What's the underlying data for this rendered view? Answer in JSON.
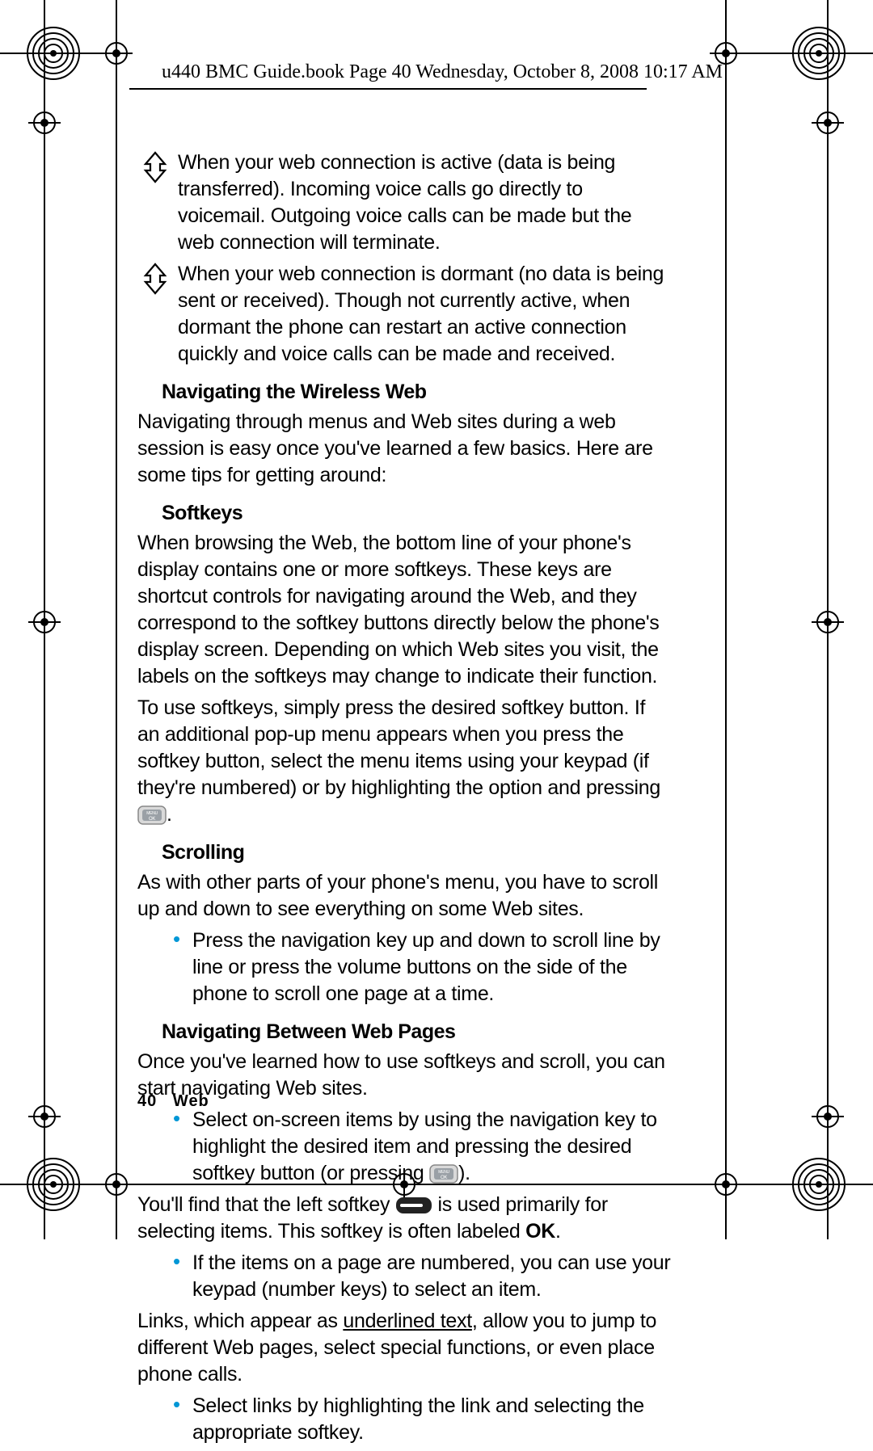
{
  "header": "u440 BMC Guide.book  Page 40  Wednesday, October 8, 2008  10:17 AM",
  "icon1_text": "When your web connection is active (data is being transferred). Incoming voice calls go directly to voicemail. Outgoing voice calls can be made but the web connection will terminate.",
  "icon2_text": "When your web connection is dormant (no data is being sent or received). Though not currently active, when dormant the phone can restart an active connection quickly and voice calls can be made and received.",
  "h_navweb": "Navigating the Wireless Web",
  "p_navweb": "Navigating through menus and Web sites during a web session is easy once you've learned a few basics. Here are some tips for getting around:",
  "h_softkeys": "Softkeys",
  "p_softkeys1": "When browsing the Web, the bottom line of your phone's display contains one or more softkeys. These keys are shortcut controls for navigating around the Web, and they correspond to the softkey buttons directly below the phone's display screen. Depending on which Web sites you visit, the labels on the softkeys may change to indicate their function.",
  "p_softkeys2a": "To use softkeys, simply press the desired softkey button. If an additional pop-up menu appears when you press the softkey button, select the menu items using your keypad (if they're numbered) or by highlighting the option and pressing ",
  "p_softkeys2b": ".",
  "h_scrolling": "Scrolling",
  "p_scrolling": "As with other parts of your phone's menu, you have to scroll up and down to see everything on some Web sites.",
  "b_scrolling": "Press the navigation key up and down to scroll line by line or press the volume buttons on the side of the phone to scroll one page at a time.",
  "h_navpages": "Navigating Between Web Pages",
  "p_navpages": "Once you've learned how to use softkeys and scroll, you can start navigating Web sites.",
  "b_navpages1a": "Select on-screen items by using the navigation key to highlight the desired item and pressing the desired softkey button (or pressing ",
  "b_navpages1b": ").",
  "p_leftsoft_a": "You'll find that the left softkey ",
  "p_leftsoft_b": " is used primarily for selecting items. This softkey is often labeled ",
  "p_leftsoft_ok": "OK",
  "p_leftsoft_c": ".",
  "b_navpages2": "If the items on a page are numbered, you can use your keypad (number keys) to select an item.",
  "p_links_a": "Links, which appear as ",
  "p_links_u": "underlined text",
  "p_links_b": ", allow you to jump to different Web pages, select special functions, or even place phone calls.",
  "b_navpages3": "Select links by highlighting the link and selecting the appropriate softkey.",
  "footer_num": "40",
  "footer_txt": "Web"
}
